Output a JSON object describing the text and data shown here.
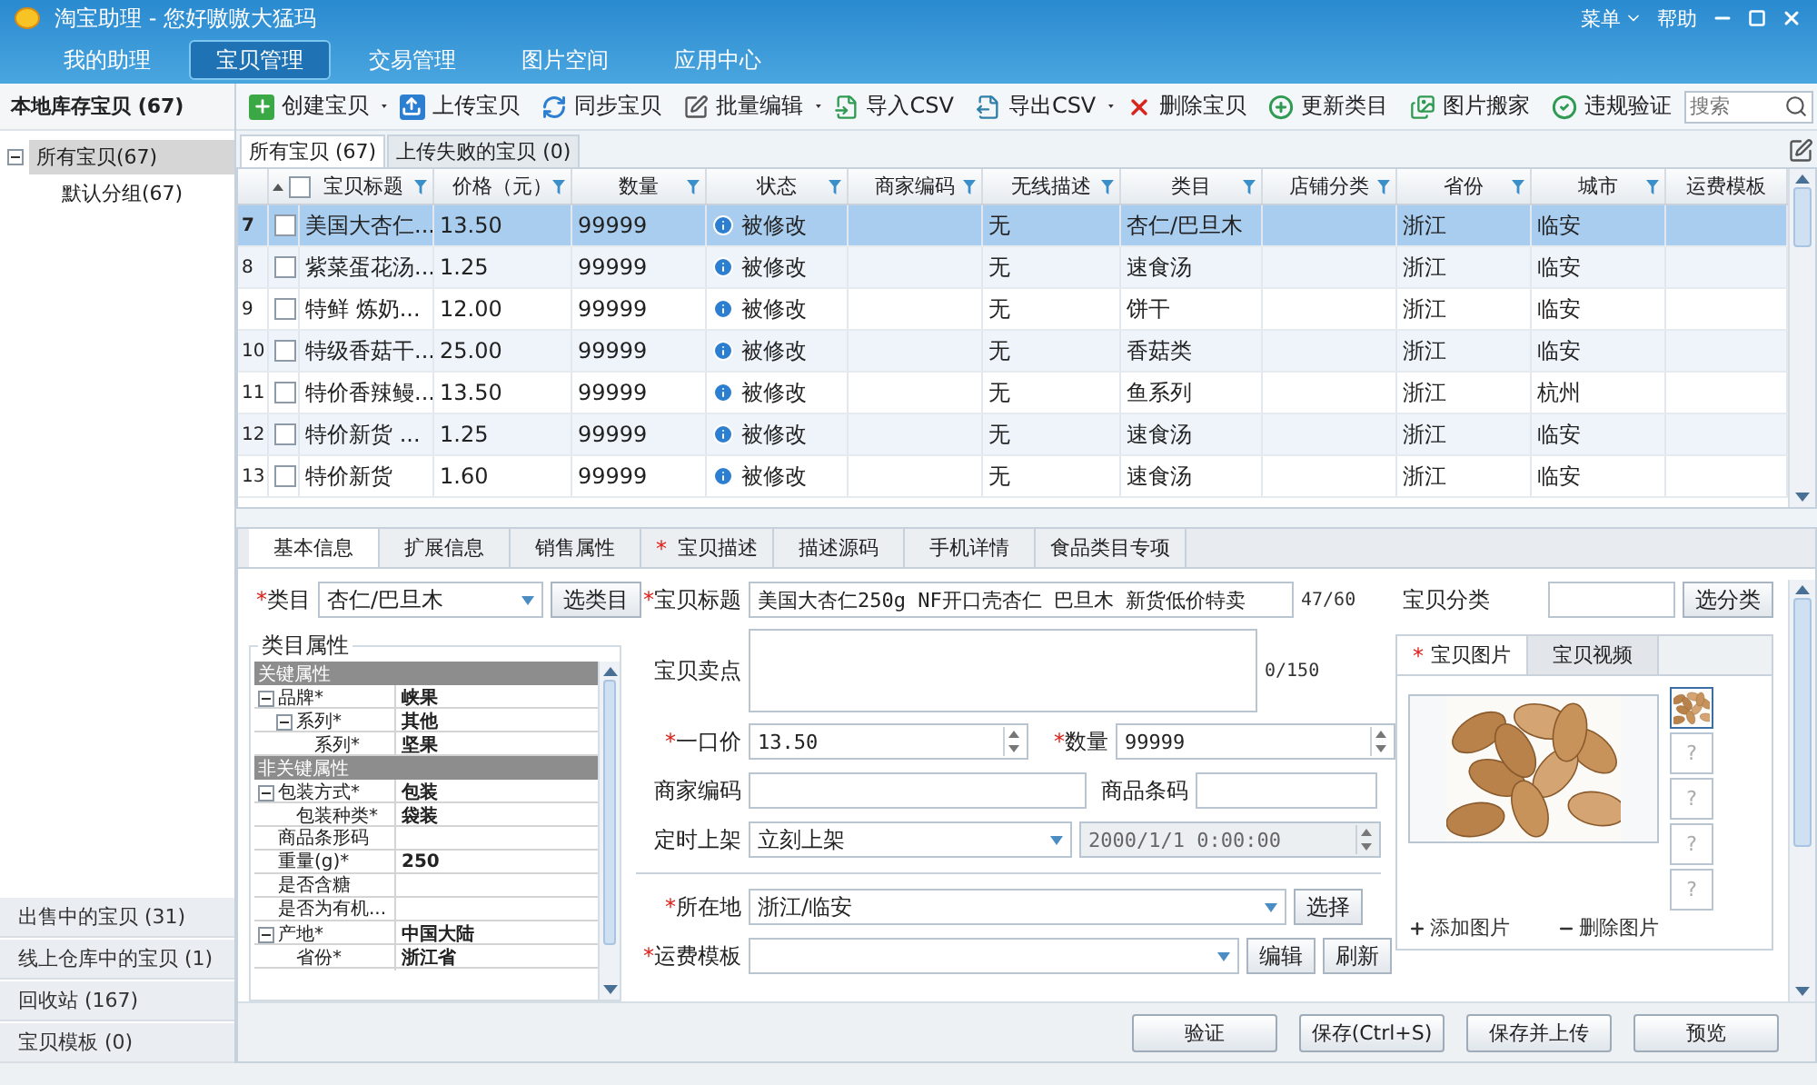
{
  "window": {
    "title": "淘宝助理 - 您好嗷嗷大猛玛",
    "menu": "菜单",
    "help": "帮助"
  },
  "nav": [
    {
      "label": "我的助理",
      "selected": false
    },
    {
      "label": "宝贝管理",
      "selected": true
    },
    {
      "label": "交易管理",
      "selected": false
    },
    {
      "label": "图片空间",
      "selected": false
    },
    {
      "label": "应用中心",
      "selected": false
    }
  ],
  "sidebar": {
    "header": "本地库存宝贝 (67)",
    "tree": [
      {
        "label": "所有宝贝(67)",
        "selected": true,
        "expanded": true,
        "children": [
          {
            "label": "默认分组(67)",
            "selected": false
          }
        ]
      }
    ],
    "bottom_items": [
      "出售中的宝贝 (31)",
      "线上仓库中的宝贝 (1)",
      "回收站 (167)",
      "宝贝模板 (0)"
    ]
  },
  "toolbar": {
    "buttons": [
      {
        "label": "创建宝贝",
        "kind": "create",
        "has_menu": true
      },
      {
        "label": "上传宝贝",
        "kind": "upload",
        "has_menu": false
      },
      {
        "label": "同步宝贝",
        "kind": "sync",
        "has_menu": false
      },
      {
        "label": "批量编辑",
        "kind": "edit",
        "has_menu": true
      },
      {
        "label": "导入CSV",
        "kind": "import",
        "has_menu": false
      },
      {
        "label": "导出CSV",
        "kind": "export",
        "has_menu": true
      },
      {
        "label": "删除宝贝",
        "kind": "delete",
        "has_menu": false
      },
      {
        "label": "更新类目",
        "kind": "update",
        "has_menu": false
      },
      {
        "label": "图片搬家",
        "kind": "images",
        "has_menu": false
      },
      {
        "label": "违规验证",
        "kind": "verify",
        "has_menu": false
      }
    ],
    "search": {
      "placeholder": "搜索"
    }
  },
  "list_tabs": [
    {
      "label": "所有宝贝 (67)",
      "selected": true
    },
    {
      "label": "上传失败的宝贝 (0)",
      "selected": false
    }
  ],
  "table": {
    "header_checked": false,
    "columns": [
      "宝贝标题",
      "价格（元）",
      "数量",
      "状态",
      "商家编码",
      "无线描述",
      "类目",
      "店铺分类",
      "省份",
      "城市",
      "运费模板"
    ],
    "rows": [
      {
        "index": "7",
        "selected": true,
        "checked": false,
        "title": "美国大杏仁...",
        "price": "13.50",
        "qty": "99999",
        "status": "被修改",
        "wireless": "无",
        "category": "杏仁/巴旦木",
        "province": "浙江",
        "city": "临安"
      },
      {
        "index": "8",
        "selected": false,
        "checked": false,
        "title": "紫菜蛋花汤...",
        "price": "1.25",
        "qty": "99999",
        "status": "被修改",
        "wireless": "无",
        "category": "速食汤",
        "province": "浙江",
        "city": "临安"
      },
      {
        "index": "9",
        "selected": false,
        "checked": false,
        "title": "特鲜 炼奶...",
        "price": "12.00",
        "qty": "99999",
        "status": "被修改",
        "wireless": "无",
        "category": "饼干",
        "province": "浙江",
        "city": "临安"
      },
      {
        "index": "10",
        "selected": false,
        "checked": false,
        "title": "特级香菇干...",
        "price": "25.00",
        "qty": "99999",
        "status": "被修改",
        "wireless": "无",
        "category": "香菇类",
        "province": "浙江",
        "city": "临安"
      },
      {
        "index": "11",
        "selected": false,
        "checked": false,
        "title": "特价香辣鳗...",
        "price": "13.50",
        "qty": "99999",
        "status": "被修改",
        "wireless": "无",
        "category": "鱼系列",
        "province": "浙江",
        "city": "杭州"
      },
      {
        "index": "12",
        "selected": false,
        "checked": false,
        "title": "特价新货 ...",
        "price": "1.25",
        "qty": "99999",
        "status": "被修改",
        "wireless": "无",
        "category": "速食汤",
        "province": "浙江",
        "city": "临安"
      },
      {
        "index": "13",
        "selected": false,
        "checked": false,
        "title": "特价新货",
        "price": "1.60",
        "qty": "99999",
        "status": "被修改",
        "wireless": "无",
        "category": "速食汤",
        "province": "浙江",
        "city": "临安"
      }
    ]
  },
  "detail": {
    "tabs": [
      {
        "label": "基本信息",
        "selected": true
      },
      {
        "label": "扩展信息",
        "selected": false
      },
      {
        "label": "销售属性",
        "selected": false
      },
      {
        "label": "宝贝描述",
        "star": "*",
        "selected": false
      },
      {
        "label": "描述源码",
        "selected": false
      },
      {
        "label": "手机详情",
        "selected": false
      },
      {
        "label": "食品类目专项",
        "selected": false
      }
    ],
    "category": {
      "star": "*",
      "label": "类目",
      "value": "杏仁/巴旦木",
      "button": "选类目"
    },
    "attributes": {
      "title": "类目属性",
      "groups": [
        {
          "label": "关键属性",
          "items": [
            {
              "name": "品牌*",
              "value": "峡果",
              "expanded": true,
              "children": [
                {
                  "name": "系列*",
                  "value": "其他",
                  "expanded": true,
                  "children": [
                    {
                      "name": "系列*",
                      "value": "坚果"
                    }
                  ]
                }
              ]
            }
          ]
        },
        {
          "label": "非关键属性",
          "items": [
            {
              "name": "包装方式*",
              "value": "包装",
              "expanded": true,
              "children": [
                {
                  "name": "包装种类*",
                  "value": "袋装"
                }
              ]
            },
            {
              "name": "商品条形码"
            },
            {
              "name": "重量(g)*",
              "value": "250"
            },
            {
              "name": "是否含糖"
            },
            {
              "name": "是否为有机..."
            },
            {
              "name": "产地*",
              "value": "中国大陆",
              "expanded": true,
              "children": [
                {
                  "name": "省份*",
                  "value": "浙江省"
                }
              ]
            }
          ]
        }
      ]
    },
    "form": {
      "title": {
        "star": "*",
        "label": "宝贝标题",
        "value": "美国大杏仁250g NF开口壳杏仁 巴旦木 新货低价特卖",
        "counter": "47/60"
      },
      "selling_points": {
        "label": "宝贝卖点",
        "counter": "0/150"
      },
      "price": {
        "star": "*",
        "label": "一口价",
        "value": "13.50"
      },
      "quantity": {
        "star": "*",
        "label": "数量",
        "value": "99999"
      },
      "merchant_code": {
        "label": "商家编码"
      },
      "barcode": {
        "label": "商品条码"
      },
      "schedule": {
        "label": "定时上架",
        "value": "立刻上架",
        "datetime": "2000/1/1 0:00:00",
        "datetime_disabled": true
      },
      "location": {
        "star": "*",
        "label": "所在地",
        "value": "浙江/临安",
        "button": "选择"
      },
      "shipping": {
        "star": "*",
        "label": "运费模板",
        "buttons": [
          "编辑",
          "刷新"
        ]
      }
    },
    "shop_category": {
      "label": "宝贝分类",
      "button": "选分类"
    },
    "media": {
      "tabs": [
        {
          "label": "宝贝图片",
          "star": "*",
          "selected": true
        },
        {
          "label": "宝贝视频",
          "selected": false
        }
      ],
      "thumbnails": [
        {
          "kind": "picture",
          "selected": true
        },
        {
          "kind": "empty",
          "symbol": "?",
          "selected": false
        },
        {
          "kind": "empty",
          "symbol": "?",
          "selected": false
        },
        {
          "kind": "empty",
          "symbol": "?",
          "selected": false
        },
        {
          "kind": "empty",
          "symbol": "?",
          "selected": false
        }
      ],
      "add": "添加图片",
      "remove": "删除图片"
    }
  },
  "footer_buttons": [
    "验证",
    "保存(Ctrl+S)",
    "保存并上传",
    "预览"
  ]
}
